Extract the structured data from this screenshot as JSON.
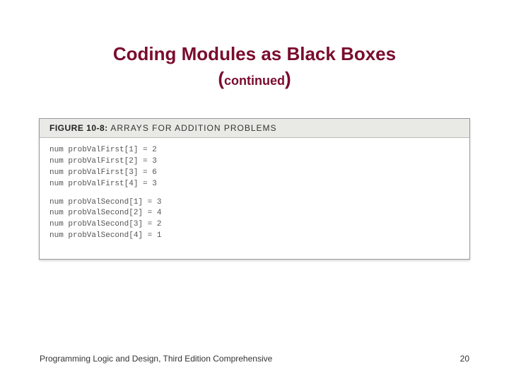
{
  "title": {
    "main": "Coding Modules as Black Boxes",
    "sub_open": "(",
    "sub_inner": "continued",
    "sub_close": ")"
  },
  "figure": {
    "label": "FIGURE 10-8:",
    "caption": "ARRAYS FOR ADDITION PROBLEMS",
    "group1": [
      "num probValFirst[1] = 2",
      "num probValFirst[2] = 3",
      "num probValFirst[3] = 6",
      "num probValFirst[4] = 3"
    ],
    "group2": [
      "num probValSecond[1] = 3",
      "num probValSecond[2] = 4",
      "num probValSecond[3] = 2",
      "num probValSecond[4] = 1"
    ]
  },
  "footer": {
    "text": "Programming Logic and Design, Third Edition Comprehensive",
    "page": "20"
  }
}
